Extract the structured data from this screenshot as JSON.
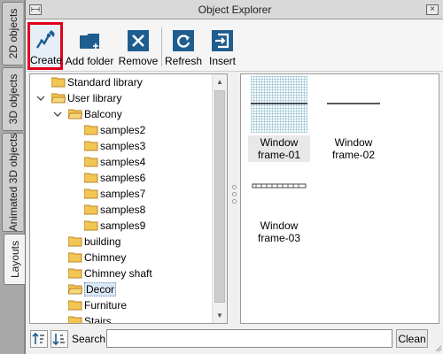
{
  "side_tabs": [
    {
      "label": "2D objects"
    },
    {
      "label": "3D objects"
    },
    {
      "label": "Animated 3D objects"
    },
    {
      "label": "Layouts"
    }
  ],
  "window": {
    "title": "Object Explorer"
  },
  "toolbar": {
    "create_label": "Create",
    "add_folder_label": "Add folder",
    "remove_label": "Remove",
    "refresh_label": "Refresh",
    "insert_label": "Insert"
  },
  "tree": {
    "items": [
      {
        "label": "Standard library"
      },
      {
        "label": "User library"
      },
      {
        "label": "Balcony"
      },
      {
        "label": "samples2"
      },
      {
        "label": "samples3"
      },
      {
        "label": "samples4"
      },
      {
        "label": "samples6"
      },
      {
        "label": "samples7"
      },
      {
        "label": "samples8"
      },
      {
        "label": "samples9"
      },
      {
        "label": "building"
      },
      {
        "label": "Chimney"
      },
      {
        "label": "Chimney shaft"
      },
      {
        "label": "Decor"
      },
      {
        "label": "Furniture"
      },
      {
        "label": "Stairs"
      }
    ]
  },
  "preview": {
    "items": [
      {
        "label": "Window frame-01"
      },
      {
        "label": "Window frame-02"
      },
      {
        "label": "Window frame-03"
      }
    ]
  },
  "search": {
    "label": "Search:",
    "value": "",
    "clean_label": "Clean"
  },
  "colors": {
    "highlight": "#e0001b",
    "folder": "#f3c552",
    "icon_blue": "#1f5d8f"
  }
}
